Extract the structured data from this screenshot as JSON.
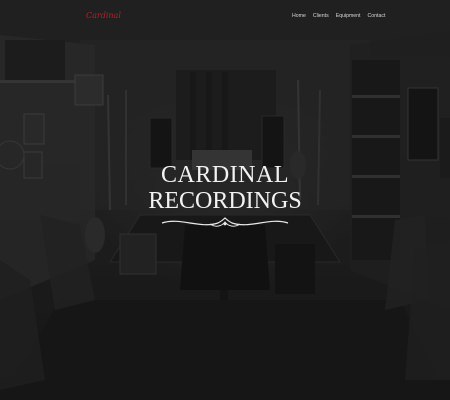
{
  "header": {
    "logo_text": "Cardinal",
    "nav": [
      {
        "label": "Home"
      },
      {
        "label": "Clients"
      },
      {
        "label": "Equipment"
      },
      {
        "label": "Contact"
      }
    ]
  },
  "hero": {
    "brand_line1": "CARDINAL",
    "brand_line2": "RECORDINGS"
  },
  "colors": {
    "accent": "#b0212a",
    "overlay": "#1f1f1f",
    "brand_text": "#f2f2f2"
  },
  "icons": [
    "ornamental-flourish-icon"
  ]
}
